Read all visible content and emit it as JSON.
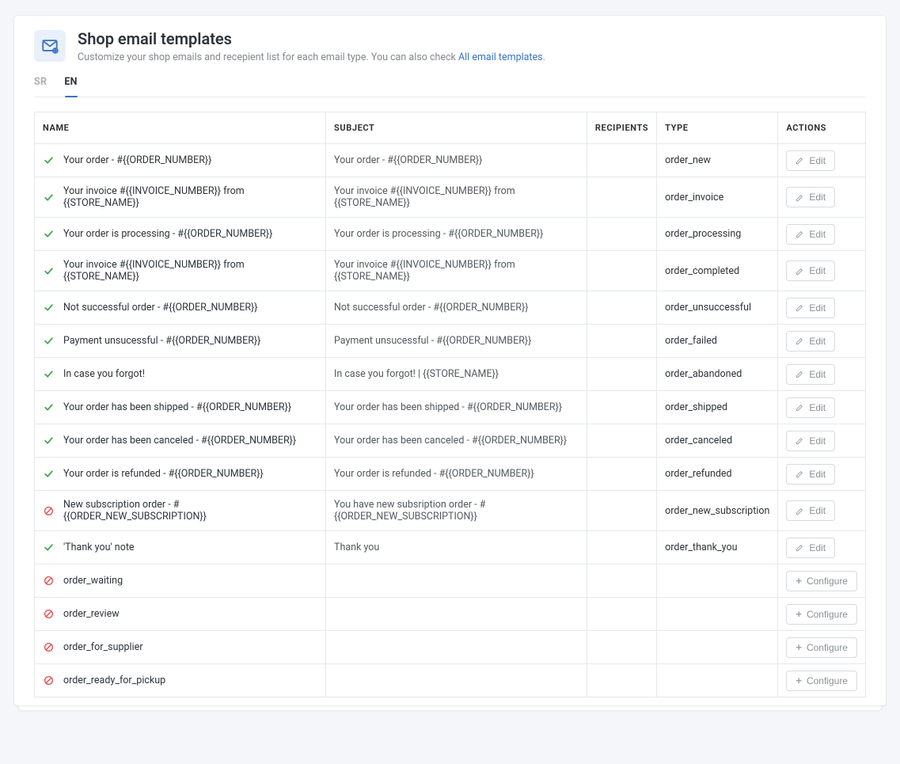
{
  "header": {
    "title": "Shop email templates",
    "subtitle_prefix": "Customize your shop emails and recepient list for each email type. You can also check ",
    "subtitle_link": "All email templates",
    "subtitle_suffix": "."
  },
  "tabs": [
    {
      "label": "SR",
      "active": false
    },
    {
      "label": "EN",
      "active": true
    }
  ],
  "columns": {
    "name": "NAME",
    "subject": "SUBJECT",
    "recipients": "RECIPIENTS",
    "type": "TYPE",
    "actions": "ACTIONS"
  },
  "buttons": {
    "edit": "Edit",
    "configure": "Configure"
  },
  "rows": [
    {
      "status": "ok",
      "name": "Your order - #{{ORDER_NUMBER}}",
      "subject": "Your order - #{{ORDER_NUMBER}}",
      "type": "order_new",
      "action": "edit"
    },
    {
      "status": "ok",
      "name": "Your invoice #{{INVOICE_NUMBER}} from {{STORE_NAME}}",
      "subject": "Your invoice #{{INVOICE_NUMBER}} from {{STORE_NAME}}",
      "type": "order_invoice",
      "action": "edit",
      "multi": true
    },
    {
      "status": "ok",
      "name": "Your order is processing - #{{ORDER_NUMBER}}",
      "subject": "Your order is processing - #{{ORDER_NUMBER}}",
      "type": "order_processing",
      "action": "edit"
    },
    {
      "status": "ok",
      "name": "Your invoice #{{INVOICE_NUMBER}} from {{STORE_NAME}}",
      "subject": "Your invoice #{{INVOICE_NUMBER}} from {{STORE_NAME}}",
      "type": "order_completed",
      "action": "edit",
      "multi": true
    },
    {
      "status": "ok",
      "name": "Not successful order - #{{ORDER_NUMBER}}",
      "subject": "Not successful order - #{{ORDER_NUMBER}}",
      "type": "order_unsuccessful",
      "action": "edit"
    },
    {
      "status": "ok",
      "name": "Payment unsucessful - #{{ORDER_NUMBER}}",
      "subject": "Payment unsucessful - #{{ORDER_NUMBER}}",
      "type": "order_failed",
      "action": "edit"
    },
    {
      "status": "ok",
      "name": "In case you forgot!",
      "subject": "In case you forgot! | {{STORE_NAME}}",
      "type": "order_abandoned",
      "action": "edit"
    },
    {
      "status": "ok",
      "name": "Your order has been shipped - #{{ORDER_NUMBER}}",
      "subject": "Your order has been shipped - #{{ORDER_NUMBER}}",
      "type": "order_shipped",
      "action": "edit"
    },
    {
      "status": "ok",
      "name": "Your order has been canceled - #{{ORDER_NUMBER}}",
      "subject": "Your order has been canceled - #{{ORDER_NUMBER}}",
      "type": "order_canceled",
      "action": "edit"
    },
    {
      "status": "ok",
      "name": "Your order is refunded - #{{ORDER_NUMBER}}",
      "subject": "Your order is refunded - #{{ORDER_NUMBER}}",
      "type": "order_refunded",
      "action": "edit"
    },
    {
      "status": "off",
      "name": "New subscription order - #{{ORDER_NEW_SUBSCRIPTION}}",
      "subject": "You have new subsription order - #{{ORDER_NEW_SUBSCRIPTION}}",
      "type": "order_new_subscription",
      "action": "edit",
      "multi": true
    },
    {
      "status": "ok",
      "name": "'Thank you' note",
      "subject": "Thank you",
      "type": "order_thank_you",
      "action": "edit"
    },
    {
      "status": "off",
      "name": "order_waiting",
      "subject": "",
      "type": "",
      "action": "configure"
    },
    {
      "status": "off",
      "name": "order_review",
      "subject": "",
      "type": "",
      "action": "configure"
    },
    {
      "status": "off",
      "name": "order_for_supplier",
      "subject": "",
      "type": "",
      "action": "configure"
    },
    {
      "status": "off",
      "name": "order_ready_for_pickup",
      "subject": "",
      "type": "",
      "action": "configure"
    }
  ]
}
